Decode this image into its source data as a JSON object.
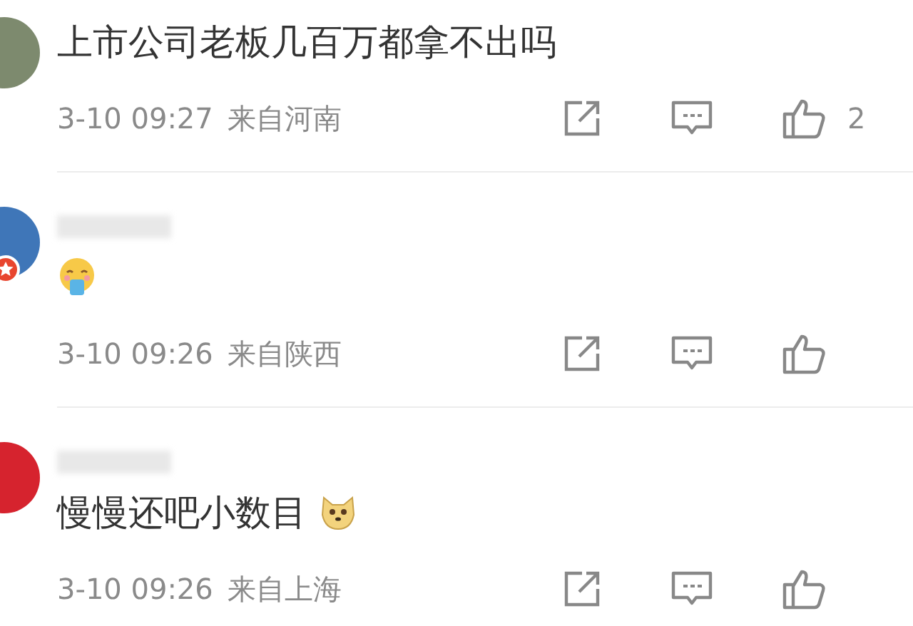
{
  "comments": [
    {
      "kind": "plain",
      "avatar": {
        "color": "#7d8a6e",
        "badge": false
      },
      "name_hidden": false,
      "text": "上市公司老板几百万都拿不出吗",
      "time": "3-10 09:27",
      "location": "来自河南",
      "likes": "2"
    },
    {
      "kind": "face",
      "avatar": {
        "color": "#3f76b8",
        "badge": true
      },
      "name_hidden": true,
      "time": "3-10 09:26",
      "location": "来自陕西"
    },
    {
      "kind": "dog",
      "avatar": {
        "color": "#d6232e",
        "badge": false
      },
      "name_hidden": true,
      "text": "慢慢还吧小数目",
      "time": "3-10 09:26",
      "location": "来自上海"
    }
  ]
}
